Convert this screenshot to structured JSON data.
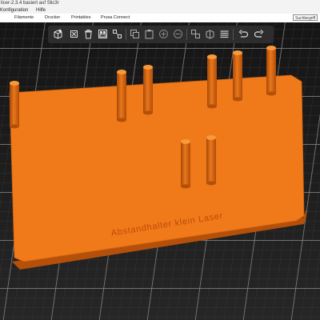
{
  "window": {
    "title": "licer-2.3.4 basiert auf Slic3r"
  },
  "menubar": {
    "items": [
      "Konfiguration",
      "Hilfe"
    ]
  },
  "nav": {
    "tabs": [
      "Filamente",
      "Drucker",
      "Printables",
      "Prusa Connect"
    ],
    "search_placeholder": "Suchbegriff"
  },
  "toolbar": {
    "buttons": [
      "add-icon",
      "delete-icon",
      "delete-all-icon",
      "arrange-icon",
      "copy-icon",
      "paste-icon",
      "add-instance-icon",
      "remove-instance-icon",
      "split-objects-icon",
      "split-parts-icon",
      "layer-editing-icon",
      "undo-icon",
      "redo-icon"
    ]
  },
  "viewport": {
    "plate_color": "#f07a1a",
    "engraving": "Abstandhalter klein Laser"
  }
}
